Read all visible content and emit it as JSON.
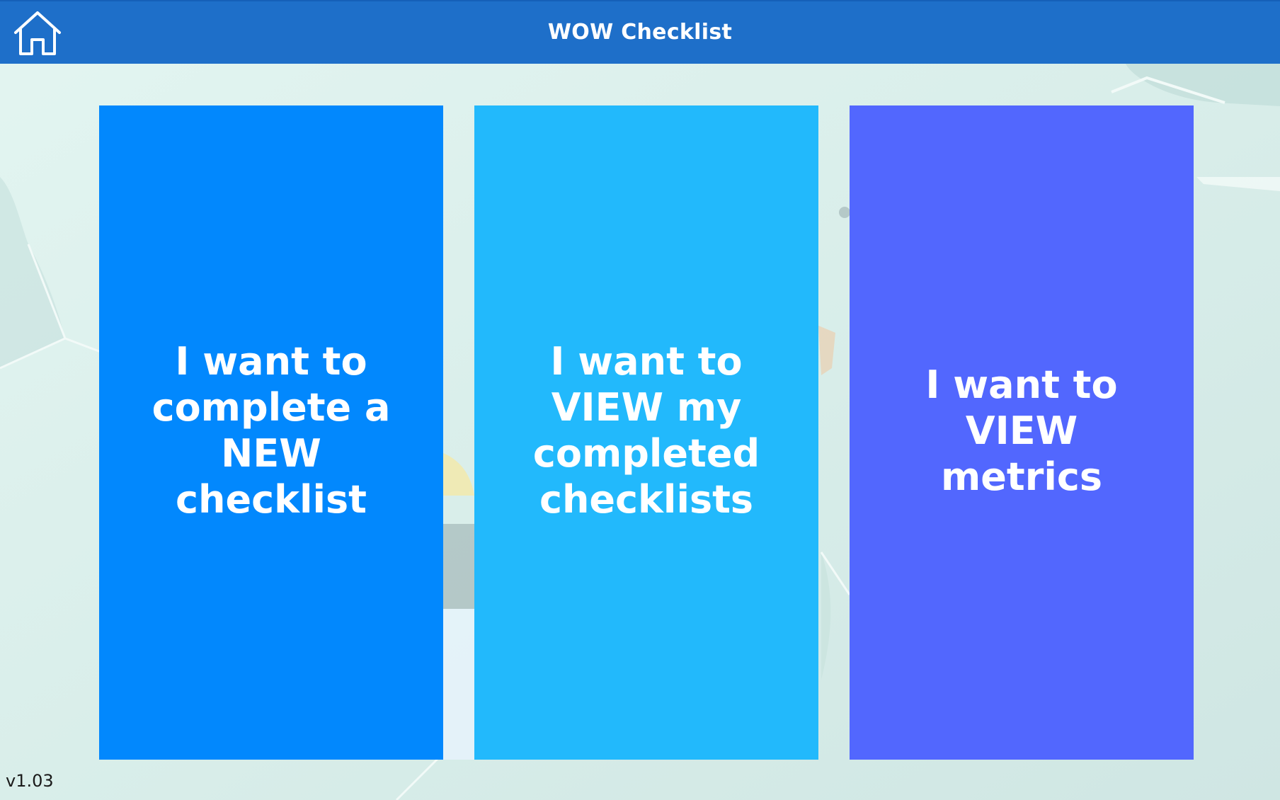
{
  "header": {
    "title": "WOW Checklist",
    "home_icon": "home-icon"
  },
  "cards": {
    "new_checklist": "I want to\ncomplete a\nNEW\n checklist",
    "view_checklists": "I want to\nVIEW my\ncompleted\n checklists",
    "view_metrics": "I want to\nVIEW\n metrics"
  },
  "footer": {
    "version": "v1.03"
  },
  "colors": {
    "header": "#1e6fc9",
    "card_new": "#0288fd",
    "card_view": "#22b9fc",
    "card_metrics": "#5267fe",
    "background": "#dcefeb"
  }
}
